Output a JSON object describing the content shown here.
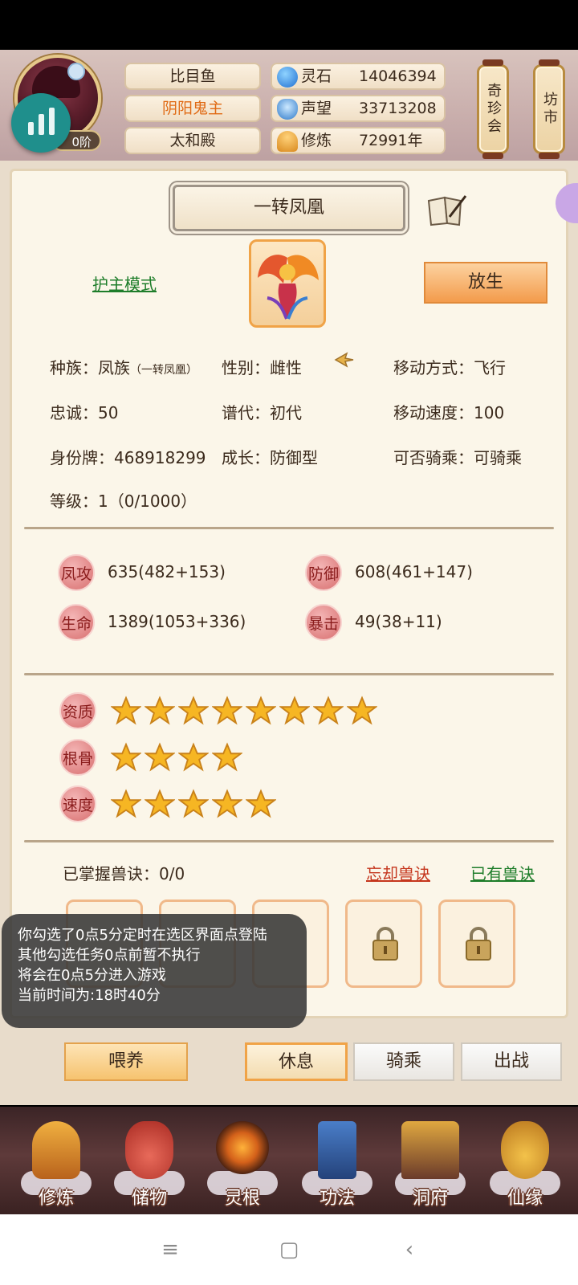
{
  "header": {
    "stage_badge": "0阶",
    "name": "比目鱼",
    "title": "阴阳鬼主",
    "location": "太和殿",
    "resources": [
      {
        "label": "灵石",
        "value": "14046394",
        "icon": "spirit-stone-icon"
      },
      {
        "label": "声望",
        "value": "33713208",
        "icon": "prestige-icon"
      },
      {
        "label": "修炼",
        "value": "72991年",
        "icon": "meditation-icon"
      }
    ],
    "lanterns": [
      "奇珍会",
      "坊市"
    ]
  },
  "pet": {
    "name": "一转凤凰",
    "guard_mode": "护主模式",
    "release": "放生",
    "info": {
      "race_label": "种族：",
      "race": "凤族",
      "race_sub": "（一转凤凰）",
      "gender_label": "性别：",
      "gender": "雌性",
      "move_label": "移动方式：",
      "move": "飞行",
      "loyalty_label": "忠诚：",
      "loyalty": "50",
      "generation_label": "谱代：",
      "generation": "初代",
      "speed_label": "移动速度：",
      "speed": "100",
      "id_label": "身份牌：",
      "id": "468918299",
      "growth_label": "成长：",
      "growth": "防御型",
      "ride_label": "可否骑乘：",
      "ride": "可骑乘",
      "level_label": "等级：",
      "level": "1（0/1000）"
    },
    "stats": [
      {
        "label": "凤攻",
        "value": "635(482+153)"
      },
      {
        "label": "防御",
        "value": "608(461+147)"
      },
      {
        "label": "生命",
        "value": "1389(1053+336)"
      },
      {
        "label": "暴击",
        "value": "49(38+11)"
      }
    ],
    "ratings": [
      {
        "label": "资质",
        "stars": 8
      },
      {
        "label": "根骨",
        "stars": 4
      },
      {
        "label": "速度",
        "stars": 5
      }
    ],
    "skills": {
      "mastered": "已掌握兽诀：0/0",
      "forget": "忘却兽诀",
      "owned": "已有兽诀"
    }
  },
  "toast": {
    "lines": [
      "你勾选了0点5分定时在选区界面点登陆",
      "其他勾选任务0点前暂不执行",
      "将会在0点5分进入游戏",
      "当前时间为:18时40分"
    ]
  },
  "actions": {
    "feed": "喂养",
    "rest": "休息",
    "ride": "骑乘",
    "battle": "出战"
  },
  "nav": [
    "修炼",
    "储物",
    "灵根",
    "功法",
    "洞府",
    "仙缘"
  ]
}
